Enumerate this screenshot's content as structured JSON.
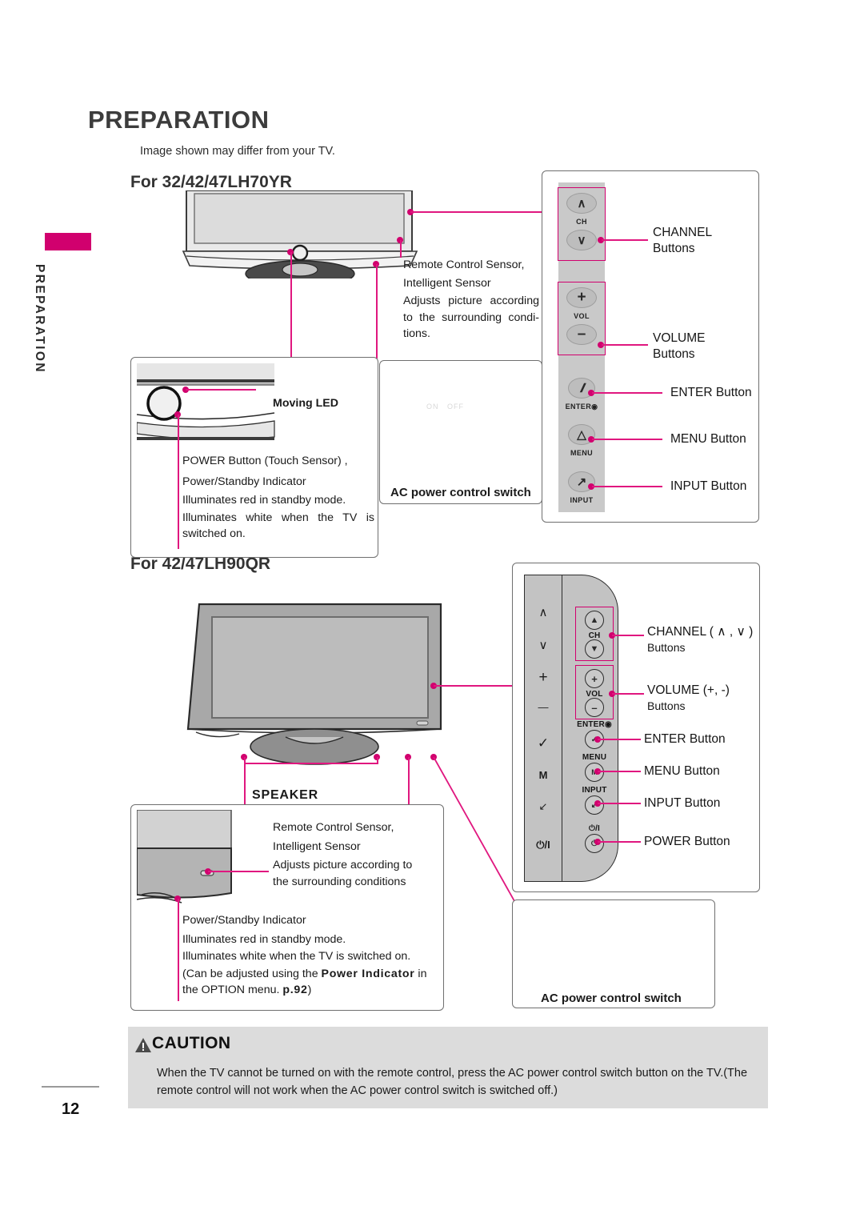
{
  "page": {
    "title": "PREPARATION",
    "subtitle": "Image shown may differ from your TV.",
    "number": "12",
    "rail_label": "PREPARATION"
  },
  "section_lh70": {
    "heading": "For 32/42/47LH70YR",
    "sensor_note": {
      "line1": "Remote Control Sensor,",
      "line2": "Intelligent Sensor",
      "body": "Adjusts picture according to the surrounding condi-tions."
    },
    "moving_led_label": "Moving LED",
    "power_note": {
      "line1": "POWER Button (Touch Sensor) ,",
      "line2": "Power/Standby Indicator",
      "body1": "Illuminates red in standby mode.",
      "body2": "Illuminates white when the TV is switched on."
    },
    "ac_switch": {
      "caption": "AC power control switch",
      "on": "ON",
      "off": "OFF"
    },
    "panel": {
      "ch_caption": "CH",
      "vol_caption": "VOL",
      "enter_caption": "ENTER◉",
      "menu_caption": "MENU",
      "input_caption": "INPUT",
      "callouts": [
        {
          "title": "CHANNEL",
          "sub": "Buttons"
        },
        {
          "title": "VOLUME",
          "sub": "Buttons"
        },
        {
          "title": "ENTER Button",
          "sub": ""
        },
        {
          "title": "MENU Button",
          "sub": ""
        },
        {
          "title": "INPUT Button",
          "sub": ""
        }
      ]
    }
  },
  "section_lh90": {
    "heading": "For 42/47LH90QR",
    "speaker_label": "SPEAKER",
    "sensor_note": {
      "line1": "Remote Control Sensor,",
      "line2": "Intelligent Sensor",
      "body1": "Adjusts picture according to",
      "body2": "the surrounding conditions"
    },
    "power_note": {
      "line1": "Power/Standby Indicator",
      "body1": "Illuminates red in standby mode.",
      "body2": "Illuminates white when the TV is switched on.",
      "body3_pre": "(Can  be  adjusted  using  the  ",
      "body3_bold": "Power Indicator",
      "body3_mid": " in the OPTION menu.  ",
      "body3_page": "p.92",
      "body3_post": ")"
    },
    "ac_switch": {
      "caption": "AC power control switch"
    },
    "panel": {
      "ch_caption": "CH",
      "vol_caption": "VOL",
      "enter_caption": "ENTER◉",
      "menu_caption": "MENU",
      "input_caption": "INPUT",
      "power_caption": "⏻/I",
      "bezel_icons": [
        "∧",
        "∨",
        "+",
        "—",
        "✓",
        "M",
        "↙",
        "⏻/I"
      ],
      "callouts": [
        {
          "title": "CHANNEL ( ∧ , ∨ )",
          "sub": "Buttons"
        },
        {
          "title": "VOLUME (+, -)",
          "sub": "Buttons"
        },
        {
          "title": "ENTER Button",
          "sub": ""
        },
        {
          "title": "MENU Button",
          "sub": ""
        },
        {
          "title": "INPUT Button",
          "sub": ""
        },
        {
          "title": "POWER Button",
          "sub": ""
        }
      ]
    }
  },
  "caution": {
    "title": "CAUTION",
    "body": "When the TV cannot be turned on with the remote control, press the AC power control switch button on the TV.(The remote control will not work when the AC power control switch is switched off.)"
  },
  "colors": {
    "accent": "#d1006e",
    "leader": "#e0177f",
    "caution_bg": "#dcdcdc",
    "panel_grey": "#c9c9c9"
  }
}
